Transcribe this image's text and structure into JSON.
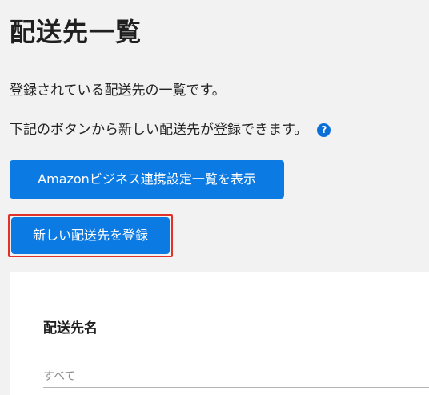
{
  "page": {
    "title": "配送先一覧",
    "description_1": "登録されている配送先の一覧です。",
    "description_2": "下記のボタンから新しい配送先が登録できます。",
    "help_icon": "question-circle-icon",
    "help_glyph": "?"
  },
  "buttons": {
    "amazon_business_label": "Amazonビジネス連携設定一覧を表示",
    "new_destination_label": "新しい配送先を登録"
  },
  "filter": {
    "label": "配送先名",
    "selected_value": "すべて"
  },
  "colors": {
    "primary": "#0b7ae3",
    "highlight_border": "#e0322b",
    "help_icon": "#0b6fd8",
    "background": "#f2f2f2",
    "card": "#ffffff"
  }
}
